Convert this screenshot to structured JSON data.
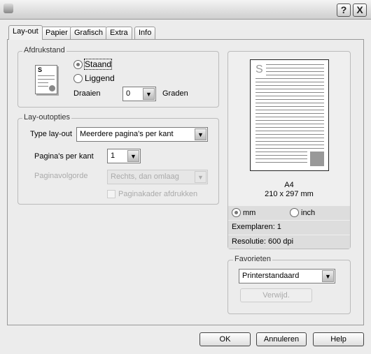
{
  "titlebar": {
    "help_label": "?",
    "close_label": "X"
  },
  "tabs": [
    {
      "label": "Lay-out",
      "active": true
    },
    {
      "label": "Papier"
    },
    {
      "label": "Grafisch"
    },
    {
      "label": "Extra"
    },
    {
      "label": "Info"
    }
  ],
  "orientation": {
    "legend": "Afdrukstand",
    "portrait": "Staand",
    "landscape": "Liggend",
    "selected": "Staand",
    "rotate_label": "Draaien",
    "rotate_value": "0",
    "rotate_unit": "Graden"
  },
  "layout": {
    "legend": "Lay-outopties",
    "type_label": "Type lay-out",
    "type_value": "Meerdere pagina's per kant",
    "pages_label": "Pagina's per kant",
    "pages_value": "1",
    "order_label": "Paginavolgorde",
    "order_value": "Rechts, dan omlaag",
    "border_label": "Paginakader afdrukken",
    "border_checked": false
  },
  "preview": {
    "page_letter": "S",
    "paper": "A4",
    "size": "210 x 297 mm",
    "unit_mm": "mm",
    "unit_inch": "inch",
    "unit_selected": "mm",
    "copies": "Exemplaren: 1",
    "resolution": "Resolutie: 600 dpi"
  },
  "favorites": {
    "legend": "Favorieten",
    "value": "Printerstandaard",
    "delete_label": "Verwijd."
  },
  "buttons": {
    "ok": "OK",
    "cancel": "Annuleren",
    "help": "Help"
  }
}
